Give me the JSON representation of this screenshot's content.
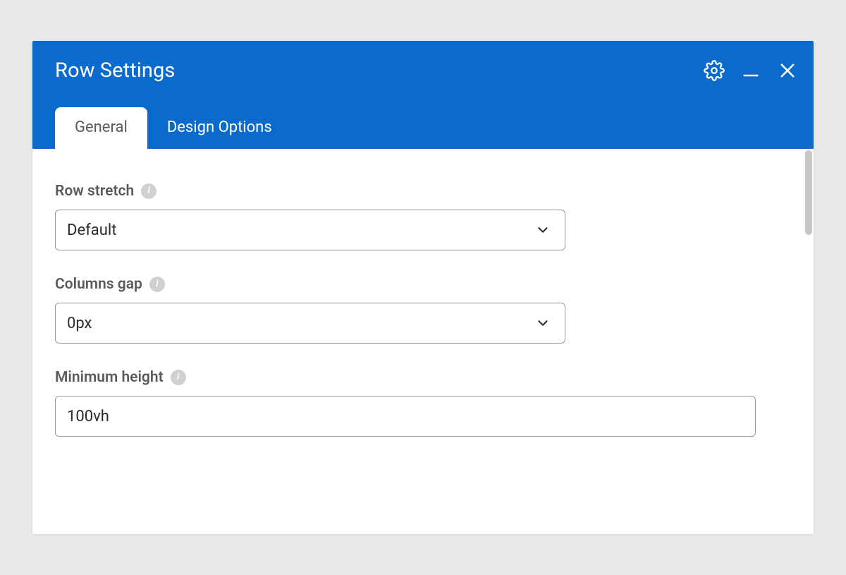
{
  "colors": {
    "accent": "#0a6bcc",
    "page_bg": "#e8e8e8",
    "text_muted": "#5b5b5b"
  },
  "header": {
    "title": "Row Settings"
  },
  "tabs": [
    {
      "label": "General",
      "active": true
    },
    {
      "label": "Design Options",
      "active": false
    }
  ],
  "fields": {
    "row_stretch": {
      "label": "Row stretch",
      "value": "Default"
    },
    "columns_gap": {
      "label": "Columns gap",
      "value": "0px"
    },
    "min_height": {
      "label": "Minimum height",
      "value": "100vh"
    }
  }
}
